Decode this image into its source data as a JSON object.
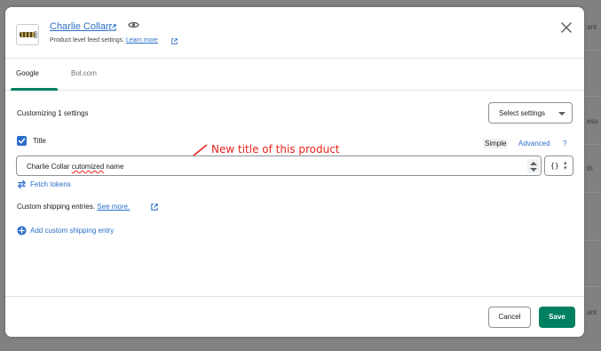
{
  "background": {
    "peek_texts": [
      "ant",
      "ess",
      "th",
      "ant"
    ]
  },
  "modal": {
    "product_title": "Charlie Collar",
    "subtitle_text": "Product level feed settings.",
    "learn_more": "Learn more",
    "close_icon": "close-icon",
    "view_icon": "eye-icon"
  },
  "tabs": [
    {
      "label": "Google",
      "active": true
    },
    {
      "label": "Bol.com",
      "active": false
    }
  ],
  "settings": {
    "customizing_label": "Customizing 1 settings",
    "select_settings_label": "Select settings"
  },
  "title_field": {
    "checked": true,
    "label": "Title",
    "mode_simple": "Simple",
    "mode_advanced": "Advanced",
    "help": "?",
    "value_prefix": "Charlie Collar ",
    "value_misspelled": "cutomized",
    "value_suffix": " name",
    "variable_button": "{}"
  },
  "annotation": {
    "text": "New title of this product",
    "color": "#e8231d"
  },
  "fetch_tokens": "Fetch tokens",
  "shipping": {
    "label": "Custom shipping entries.",
    "see_more": "See more.",
    "add_entry": "Add custom shipping entry"
  },
  "footer": {
    "cancel": "Cancel",
    "save": "Save"
  },
  "colors": {
    "primary_green": "#008060",
    "link_blue": "#2c6ecb",
    "overlay": "#7f8183"
  }
}
